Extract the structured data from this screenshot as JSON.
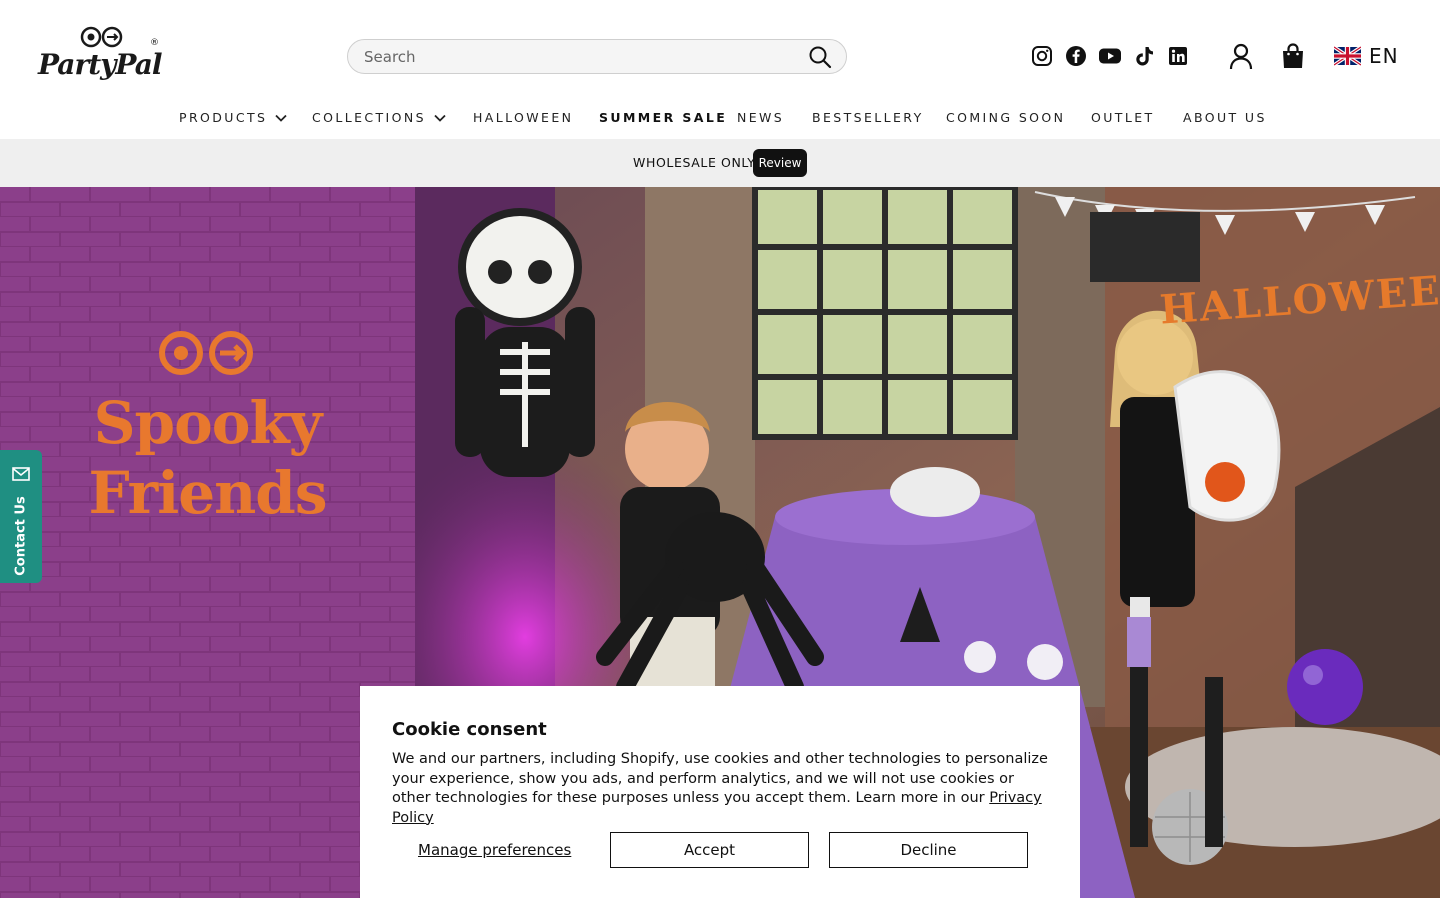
{
  "header": {
    "logo_text": "PartyPal",
    "logo_reg": "®",
    "search": {
      "placeholder": "Search"
    },
    "social_icons": [
      "instagram-icon",
      "facebook-icon",
      "youtube-icon",
      "tiktok-icon",
      "linkedin-icon"
    ],
    "language": {
      "flag": "uk-flag-icon",
      "code": "EN"
    }
  },
  "nav": {
    "items": [
      {
        "label": "PRODUCTS",
        "has_dropdown": true
      },
      {
        "label": "COLLECTIONS",
        "has_dropdown": true
      },
      {
        "label": "HALLOWEEN"
      },
      {
        "label": "SUMMER SALE",
        "bold": true
      },
      {
        "label": "NEWS"
      },
      {
        "label": "BESTSELLERY"
      },
      {
        "label": "COMING SOON"
      },
      {
        "label": "OUTLET"
      },
      {
        "label": "ABOUT US"
      }
    ]
  },
  "announcement": {
    "text": "WHOLESALE ONLY",
    "badge": "Review"
  },
  "hero": {
    "brand_line1": "Spooky",
    "brand_line2": "Friends",
    "photo_banner": "HALLOWEEN",
    "left_color": "#8b3f8a",
    "accent_color": "#e8782e"
  },
  "contact_tab": {
    "label": "Contact Us",
    "color": "#1f8f82"
  },
  "cookie": {
    "title": "Cookie consent",
    "body": "We and our partners, including Shopify, use cookies and other technologies to personalize your experience, show you ads, and perform analytics, and we will not use cookies or other technologies for these purposes unless you accept them. Learn more in our ",
    "link": "Privacy Policy",
    "manage": "Manage preferences",
    "accept": "Accept",
    "decline": "Decline"
  }
}
